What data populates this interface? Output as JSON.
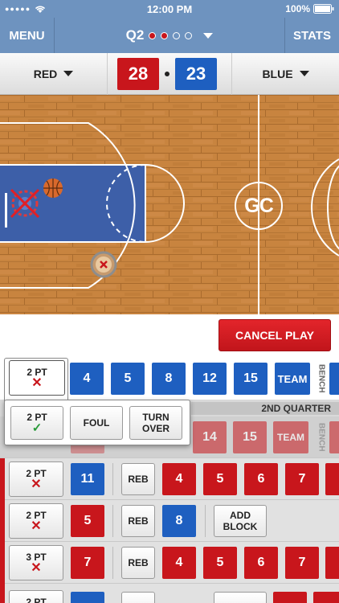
{
  "status": {
    "time": "12:00 PM",
    "battery": "100%",
    "signal": "●●●●●"
  },
  "nav": {
    "menu": "MENU",
    "stats": "STATS",
    "quarter": "Q2",
    "quarter_dots": [
      true,
      true,
      false,
      false
    ]
  },
  "score": {
    "team_left": "RED",
    "team_right": "BLUE",
    "score_left": "28",
    "score_right": "23",
    "colors": {
      "red": "#c8161c",
      "blue": "#1e5fc0"
    }
  },
  "court": {
    "logo": "GC"
  },
  "action": {
    "cancel": "CANCEL PLAY"
  },
  "active_row": {
    "shot": "2 PT",
    "players": [
      "4",
      "5",
      "8",
      "12",
      "15"
    ],
    "team": "TEAM",
    "bench": "BENCH"
  },
  "popup": {
    "made": "2 PT",
    "foul": "FOUL",
    "turnover_line1": "TURN",
    "turnover_line2": "OVER"
  },
  "quarter_header": "2ND QUARTER",
  "ghost_row": {
    "players": [
      "14",
      "15"
    ],
    "team": "TEAM",
    "bench": "BENCH"
  },
  "rows": [
    {
      "shot": "2 PT",
      "shooter": "11",
      "reb": "REB",
      "reb_players": [
        "4",
        "5",
        "6",
        "7"
      ]
    },
    {
      "shot": "2 PT",
      "shooter": "5",
      "reb": "REB",
      "reb_player": "8",
      "block_line1": "ADD",
      "block_line2": "BLOCK"
    },
    {
      "shot": "3 PT",
      "shooter": "7",
      "reb": "REB",
      "reb_players": [
        "4",
        "5",
        "6",
        "7"
      ]
    },
    {
      "shot": "2 PT",
      "shooter": "",
      "reb": "AST",
      "def": "DEF"
    }
  ]
}
